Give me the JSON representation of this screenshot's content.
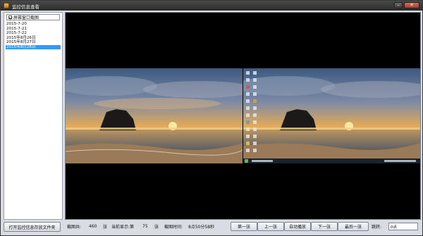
{
  "window": {
    "title": "监控信息查看"
  },
  "window_controls": {
    "minimize": "–",
    "close": "✕"
  },
  "sidebar": {
    "filter_label": "屏幕窗口截图",
    "dates": [
      "2015-7-20",
      "2015-7-21",
      "2015-7-22",
      "2015年8月26日",
      "2015年8月27日",
      "2015年8月28日"
    ],
    "selected_index": 5,
    "open_folder_button": "打开监控信息存放文件夹"
  },
  "status": {
    "total_label": "截图共:",
    "total_value": "460",
    "unit1": "张",
    "current_label": "当前显示:第",
    "current_value": "75",
    "unit2": "张",
    "time_label": "截图时间:",
    "time_value": "8点50分58秒"
  },
  "nav": {
    "first": "第一张",
    "prev": "上一张",
    "autoplay": "自动播放",
    "next": "下一张",
    "last": "最后一张",
    "jump_label": "跳转:",
    "jump_value": "0点"
  },
  "colors": {
    "selection": "#3399ff",
    "titlebar": "#2b2b2b",
    "viewer_bg": "#000000"
  },
  "icons": [
    "app-icon",
    "minimize-icon",
    "close-icon",
    "checkbox-icon"
  ]
}
